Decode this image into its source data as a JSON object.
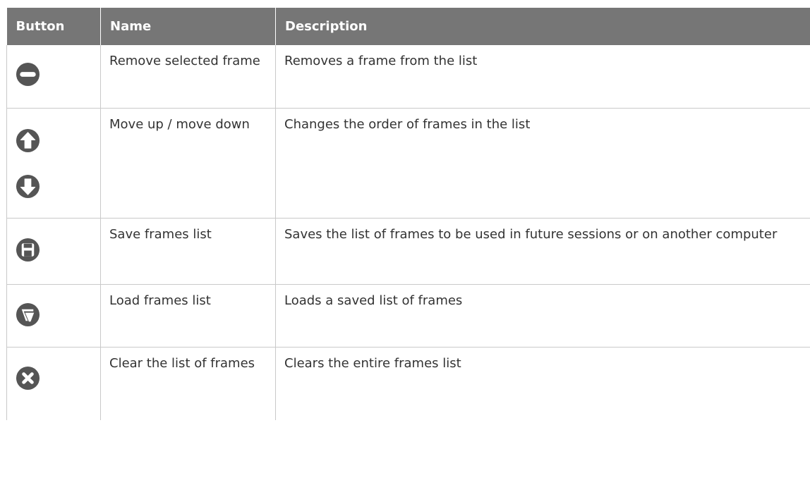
{
  "table": {
    "headers": {
      "button": "Button",
      "name": "Name",
      "description": "Description"
    },
    "rows": [
      {
        "icons": [
          "minus-circle-icon"
        ],
        "name": "Remove selected frame",
        "description": "Removes a frame from the list"
      },
      {
        "icons": [
          "arrow-up-circle-icon",
          "arrow-down-circle-icon"
        ],
        "name": "Move up / move down",
        "description": "Changes the order of frames in the list"
      },
      {
        "icons": [
          "floppy-disk-icon"
        ],
        "name": "Save frames list",
        "description": "Saves the list of frames to be used in future sessions or on another computer"
      },
      {
        "icons": [
          "folder-open-icon"
        ],
        "name": "Load frames list",
        "description": "Loads a saved list of frames"
      },
      {
        "icons": [
          "close-circle-icon"
        ],
        "name": "Clear the list of frames",
        "description": "Clears the entire frames list"
      }
    ]
  },
  "colors": {
    "header_bg": "#767676",
    "header_text": "#ffffff",
    "icon_fill": "#555555",
    "grid_line": "#c9c9c9",
    "body_text": "#333333"
  }
}
